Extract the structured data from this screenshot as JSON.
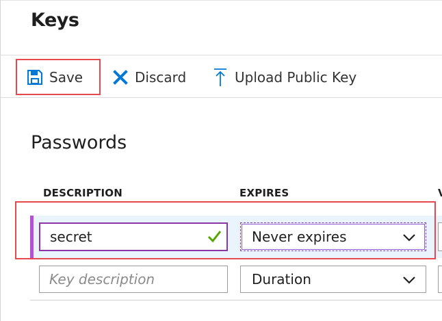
{
  "page": {
    "title": "Keys"
  },
  "toolbar": {
    "save_label": "Save",
    "discard_label": "Discard",
    "upload_label": "Upload Public Key"
  },
  "passwords": {
    "title": "Passwords",
    "columns": {
      "description": "DESCRIPTION",
      "expires": "EXPIRES",
      "value": "V"
    },
    "rows": [
      {
        "description": "secret",
        "expires": "Never expires",
        "valid": true
      },
      {
        "description_placeholder": "Key description",
        "expires": "Duration"
      }
    ]
  },
  "colors": {
    "accent_blue": "#0078d4",
    "highlight_red": "#e5484d",
    "row_accent_purple": "#b44fd6",
    "row_selected_bg": "#e9f4fd",
    "check_green": "#57a300"
  },
  "icons": [
    "save-icon",
    "close-icon",
    "upload-icon",
    "check-icon",
    "chevron-down-icon"
  ]
}
